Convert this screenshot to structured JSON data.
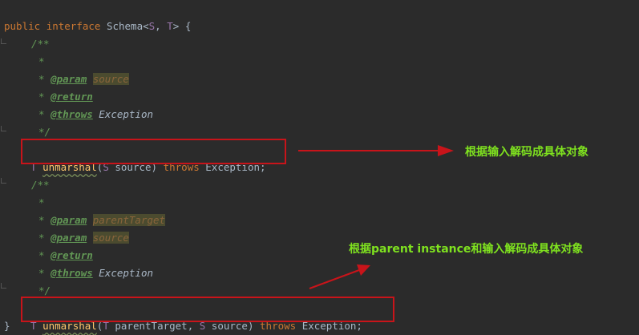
{
  "editor": {
    "header": {
      "public": "public",
      "interface": "interface",
      "name": "Schema<",
      "s": "S",
      "comma": ", ",
      "t": "T",
      "close": "> {"
    },
    "doc1": {
      "open": "/**",
      "star": "*",
      "param_tag": "@param",
      "param_name": "source",
      "return_tag": "@return",
      "throws_tag": "@throws",
      "exception": "Exception",
      "close": "*/"
    },
    "method1": {
      "ret": "T",
      "name": "unmarshal",
      "open": "(",
      "ptype": "S",
      "pname": " source) ",
      "throws": "throws",
      "rest": " Exception;"
    },
    "doc2": {
      "open": "/**",
      "star": "*",
      "param_tag": "@param",
      "param1_name": "parentTarget",
      "param2_name": "source",
      "return_tag": "@return",
      "throws_tag": "@throws",
      "exception": "Exception",
      "close": "*/"
    },
    "method2": {
      "ret": "T",
      "name": "unmarshal",
      "open": "(",
      "ptype1": "T",
      "pname1": " parentTarget, ",
      "ptype2": "S",
      "pname2": " source) ",
      "throws": "throws",
      "rest": " Exception;"
    },
    "closing_brace": "}"
  },
  "annotations": {
    "first": "根据输入解码成具体对象",
    "second": "根据parent  instance和输入解码成具体对象"
  },
  "colors": {
    "highlight_box": "#c8141a",
    "annotation": "#7fe21f"
  }
}
